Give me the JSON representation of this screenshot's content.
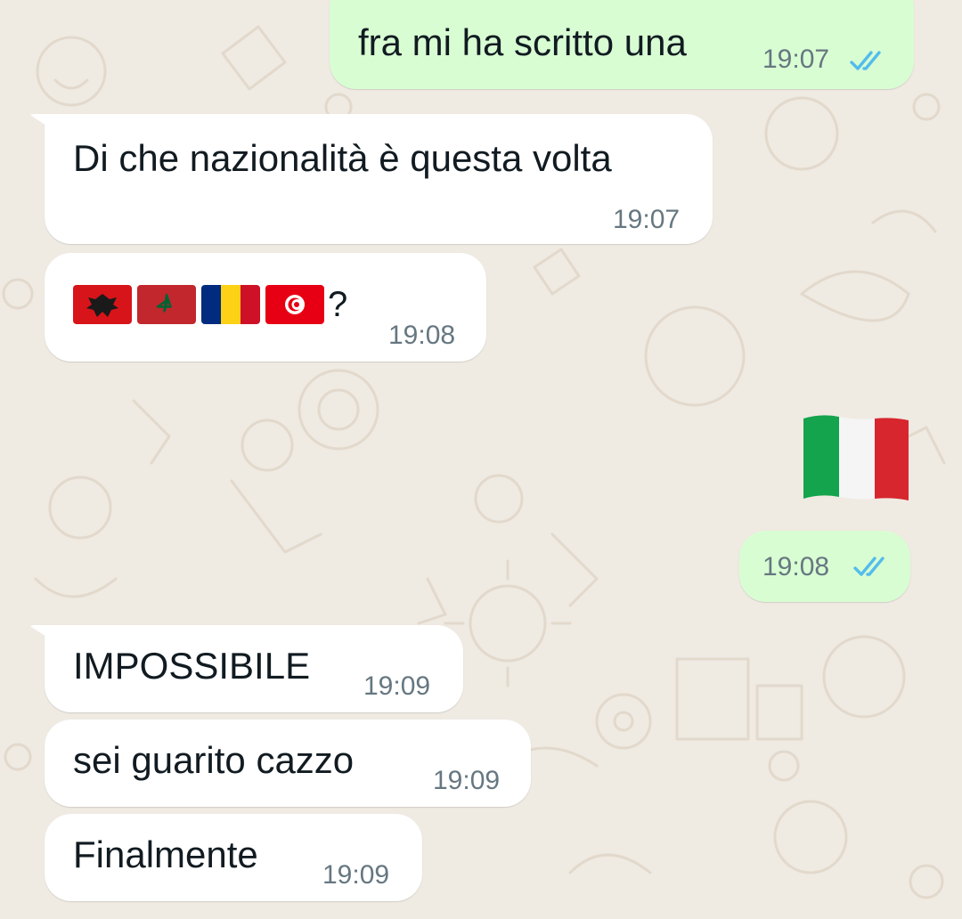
{
  "colors": {
    "background": "#efeae2",
    "incoming_bubble": "#ffffff",
    "outgoing_bubble": "#d9fdd3",
    "timestamp": "#667781",
    "read_ticks": "#53bdeb"
  },
  "messages": [
    {
      "direction": "outgoing",
      "text": "fra mi ha scritto una",
      "time": "19:07",
      "status": "read"
    },
    {
      "direction": "incoming",
      "text": "Di che nazionalità è questa volta",
      "time": "19:07"
    },
    {
      "direction": "incoming",
      "flags": [
        "albania-flag-icon",
        "morocco-flag-icon",
        "romania-flag-icon",
        "tunisia-flag-icon"
      ],
      "suffix": "?",
      "time": "19:08"
    },
    {
      "direction": "outgoing",
      "sticker": "italy-flag-icon"
    },
    {
      "direction": "outgoing",
      "text": "",
      "time": "19:08",
      "status": "read"
    },
    {
      "direction": "incoming",
      "text": "IMPOSSIBILE",
      "time": "19:09"
    },
    {
      "direction": "incoming",
      "text": "sei guarito cazzo",
      "time": "19:09"
    },
    {
      "direction": "incoming",
      "text": "Finalmente",
      "time": "19:09"
    }
  ]
}
